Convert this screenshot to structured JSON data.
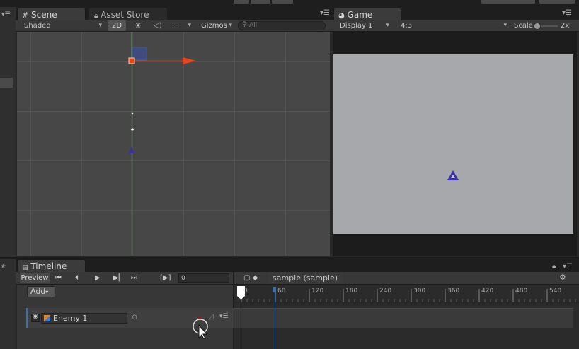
{
  "scene_panel": {
    "tab_label": "Scene",
    "asset_tab_label": "Asset Store",
    "shading_mode": "Shaded",
    "mode_2d": "2D",
    "gizmos_label": "Gizmos",
    "search_placeholder": "All"
  },
  "game_panel": {
    "tab_label": "Game",
    "display": "Display 1",
    "aspect": "4:3",
    "scale_label": "Scale",
    "scale_value": "2x",
    "background_color": "#a6a8ab"
  },
  "timeline_panel": {
    "tab_label": "Timeline",
    "preview_label": "Preview",
    "frame_value": "0",
    "sequence_name": "sample (sample)",
    "add_label": "Add",
    "track_name": "Enemy 1",
    "ruler_labels": [
      "0",
      "60",
      "120",
      "180",
      "240",
      "300",
      "360",
      "420",
      "480",
      "540"
    ]
  },
  "colors": {
    "accent": "#3a6fb0",
    "enemy": "#3a2fa8",
    "gizmo_x": "#e8431a"
  }
}
